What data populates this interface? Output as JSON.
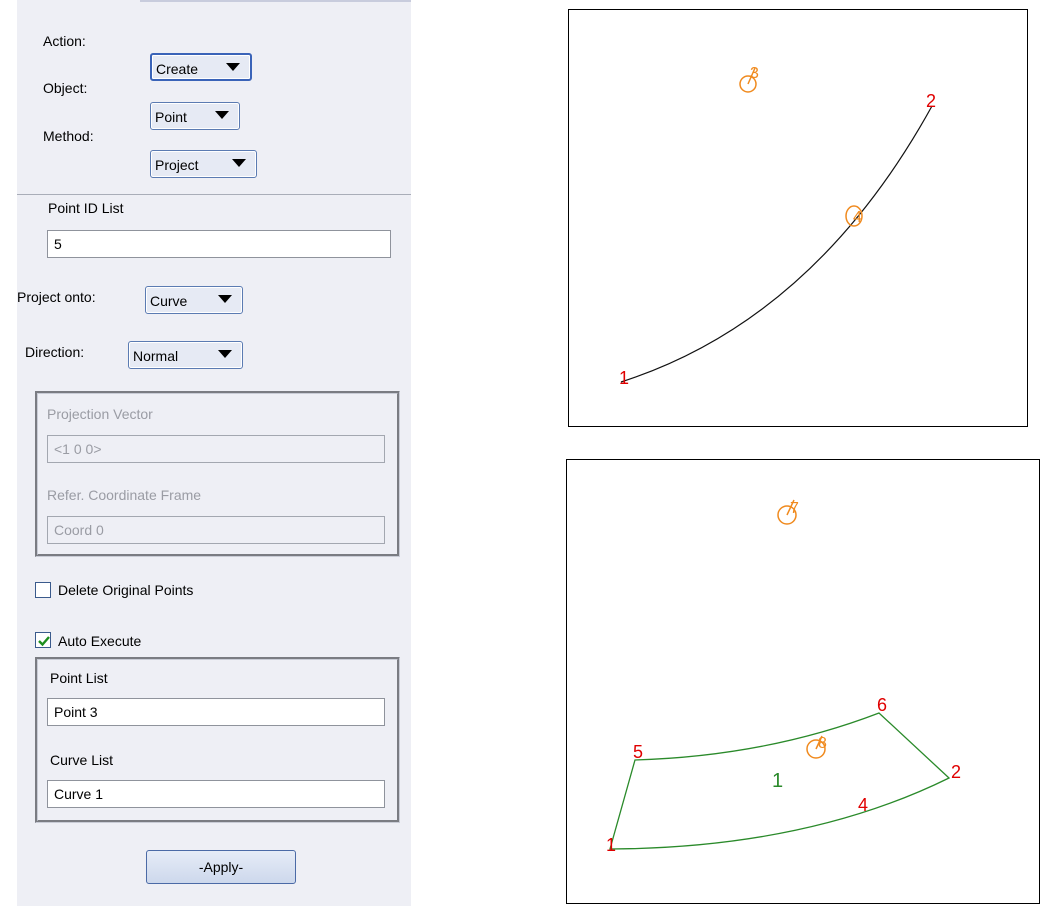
{
  "form": {
    "action_label": "Action:",
    "action_value": "Create",
    "object_label": "Object:",
    "object_value": "Point",
    "method_label": "Method:",
    "method_value": "Project",
    "point_id_list_label": "Point ID List",
    "point_id_list_value": "5",
    "project_onto_label": "Project onto:",
    "project_onto_value": "Curve",
    "direction_label": "Direction:",
    "direction_value": "Normal",
    "projection_vector_label": "Projection Vector",
    "projection_vector_value": "<1 0 0>",
    "refer_frame_label": "Refer. Coordinate Frame",
    "refer_frame_value": "Coord 0",
    "delete_original_label": "Delete Original Points",
    "delete_original_checked": false,
    "auto_execute_label": "Auto Execute",
    "auto_execute_checked": true,
    "point_list_label": "Point List",
    "point_list_value": "Point 3",
    "curve_list_label": "Curve List",
    "curve_list_value": "Curve 1",
    "apply_label": "-Apply-"
  },
  "viewport_top": {
    "node_labels": {
      "n1": "1",
      "n2": "2",
      "n3": "3",
      "n4": "4"
    }
  },
  "viewport_bottom": {
    "node_labels": {
      "n1": "1",
      "n2": "2",
      "n4": "4",
      "n5": "5",
      "n6": "6",
      "n7": "7",
      "n8": "8"
    },
    "surface_label": "1"
  },
  "colors": {
    "node_label": "#e00000",
    "point_marker": "#f08a1e",
    "curve": "#111111",
    "surface_edge": "#2a8a2a",
    "surface_label": "#2a8a2a"
  }
}
